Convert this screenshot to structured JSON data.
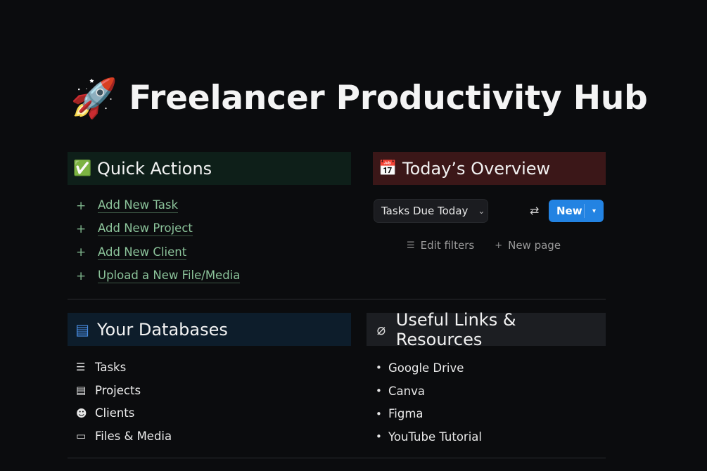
{
  "page": {
    "icon": "🚀",
    "icon_name": "rocket-icon",
    "title": "Freelancer Productivity Hub"
  },
  "quick_actions": {
    "icon": "✅",
    "title": "Quick Actions",
    "items": [
      {
        "icon": "+",
        "label": "Add New Task"
      },
      {
        "icon": "+",
        "label": "Add New Project"
      },
      {
        "icon": "+",
        "label": "Add New Client"
      },
      {
        "icon": "+",
        "label": "Upload a New File/Media"
      }
    ]
  },
  "overview": {
    "icon": "📅",
    "title": "Today’s Overview",
    "view": "Tasks Due Today",
    "view_chevron": "⌄",
    "sort_icon": "⇄",
    "new_button": "New",
    "new_caret": "▾",
    "edit_filters": "Edit filters",
    "edit_filters_icon": "☰",
    "new_page": "New page",
    "new_page_icon": "+"
  },
  "databases": {
    "icon": "▤",
    "title": "Your Databases",
    "items": [
      {
        "icon": "☰",
        "icon_name": "list-icon",
        "label": "Tasks"
      },
      {
        "icon": "▤",
        "icon_name": "clipboard-icon",
        "label": "Projects"
      },
      {
        "icon": "☻",
        "icon_name": "people-icon",
        "label": "Clients"
      },
      {
        "icon": "▭",
        "icon_name": "folder-icon",
        "label": "Files & Media"
      }
    ]
  },
  "links": {
    "icon": "⌀",
    "title": "Useful Links & Resources",
    "items": [
      {
        "label": "Google Drive"
      },
      {
        "label": "Canva"
      },
      {
        "label": "Figma"
      },
      {
        "label": "YouTube Tutorial"
      }
    ]
  },
  "colors": {
    "background": "#0b0c0e",
    "accent": "#2383e2",
    "quick_actions_bg": "#0e1f19",
    "overview_bg": "#3b1718",
    "databases_bg": "#0d1d2b",
    "links_bg": "#1c1e22",
    "link_text": "#8bc39a"
  }
}
